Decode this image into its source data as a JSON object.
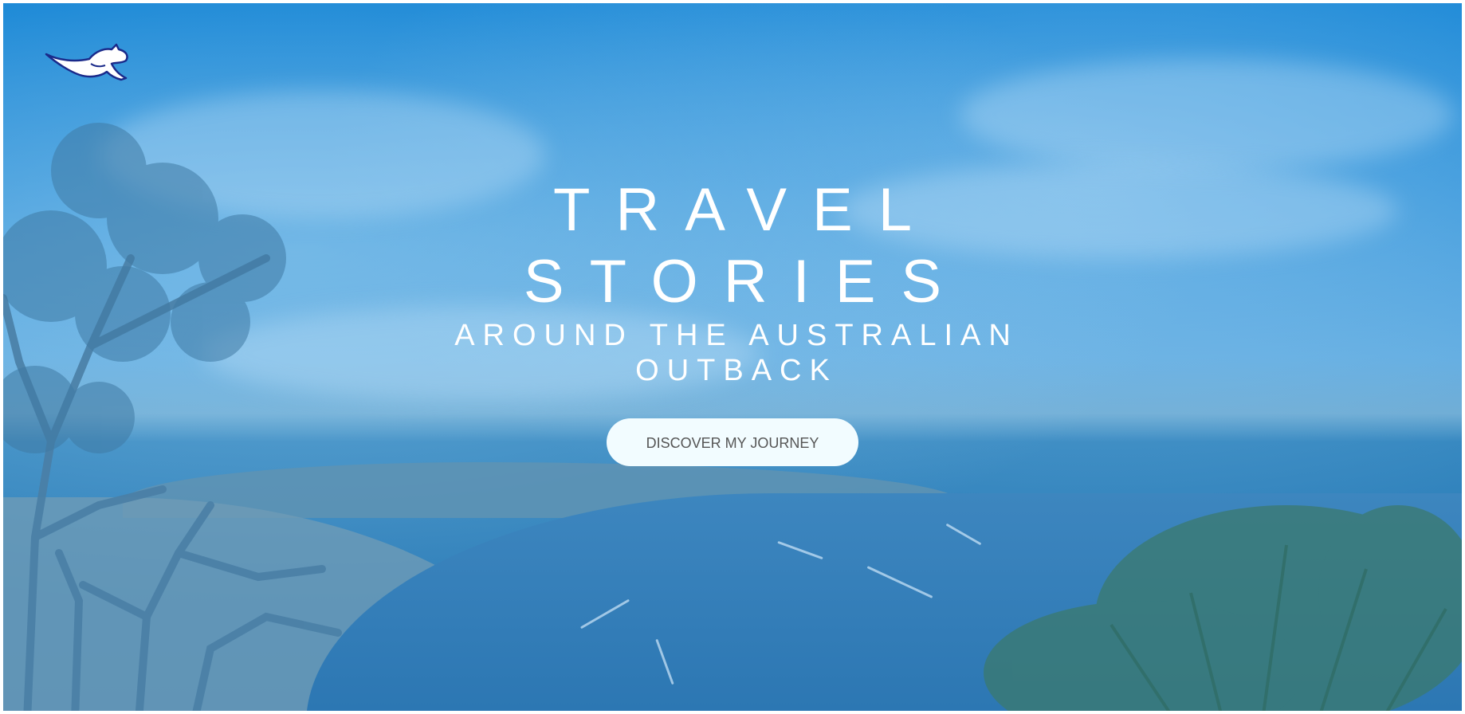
{
  "hero": {
    "title_line1": "TRAVEL",
    "title_line2": "STORIES",
    "subtitle_line1": "AROUND THE AUSTRALIAN",
    "subtitle_line2": "OUTBACK",
    "cta_label": "DISCOVER MY JOURNEY"
  },
  "branding": {
    "logo_icon": "kangaroo-icon"
  },
  "colors": {
    "sky_top": "#0a7fd3",
    "sky_mid": "#5aa8df",
    "ocean": "#2b76b2",
    "text": "#ffffff",
    "button_bg": "#f2fcff",
    "button_text": "#555555"
  }
}
